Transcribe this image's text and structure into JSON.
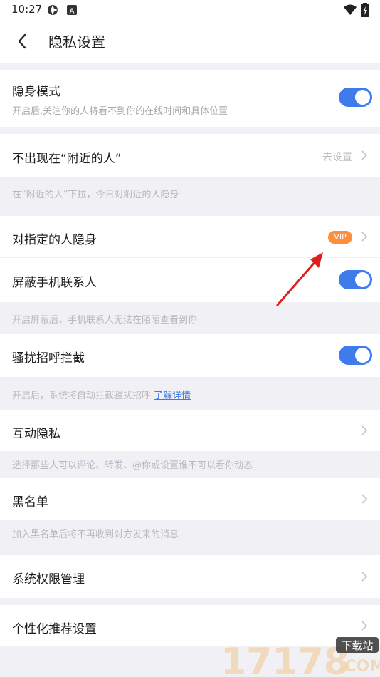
{
  "status_bar": {
    "time": "10:27"
  },
  "header": {
    "title": "隐私设置"
  },
  "stealth": {
    "label": "隐身模式",
    "sub": "开启后,关注你的人将看不到你的在线时间和具体位置"
  },
  "nearby": {
    "label": "不出现在“附近的人”",
    "action": "去设置",
    "note": "在“附近的人”下拉，今日对附近的人隐身"
  },
  "specific": {
    "label": "对指定的人隐身",
    "badge": "VIP"
  },
  "contacts": {
    "label": "屏蔽手机联系人",
    "note": "开启屏蔽后，手机联系人无法在陌陌查看到你"
  },
  "harass": {
    "label": "骚扰招呼拦截",
    "note": "开启后，系统将自动拦截骚扰招呼",
    "link": "了解详情"
  },
  "interact": {
    "label": "互动隐私",
    "note": "选择那些人可以评论、转发、@你或设置谁不可以看你动态"
  },
  "blacklist": {
    "label": "黑名单",
    "note": "加入黑名单后将不再收到对方发来的消息"
  },
  "permissions": {
    "label": "系统权限管理"
  },
  "personalize": {
    "label": "个性化推荐设置"
  },
  "watermark": {
    "brand": "17178",
    "tag": "下载站",
    "domain": ".COM"
  }
}
